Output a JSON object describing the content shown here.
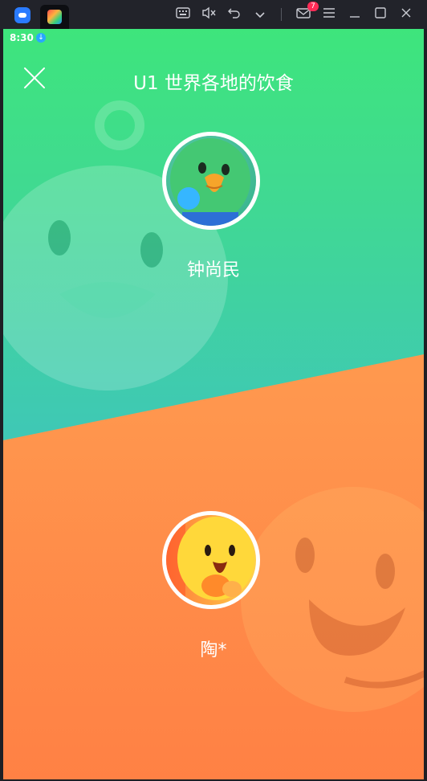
{
  "status": {
    "time": "8:30"
  },
  "emulator": {
    "notification_count": "7"
  },
  "header": {
    "title": "U1 世界各地的饮食"
  },
  "players": [
    {
      "name": "钟尚民"
    },
    {
      "name": "陶*"
    }
  ],
  "colors": {
    "green_top": "#3ee57c",
    "green_bottom": "#3fc7b7",
    "orange_top": "#ffad5a",
    "orange_bottom": "#ff8447"
  }
}
